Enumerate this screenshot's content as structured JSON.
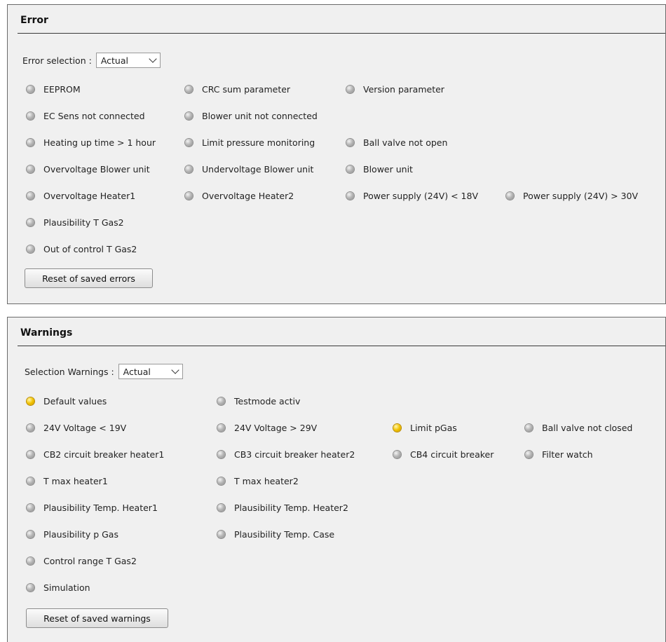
{
  "error_panel": {
    "title": "Error",
    "selection_label": "Error selection :",
    "selection_value": "Actual",
    "items": [
      {
        "label": "EEPROM",
        "color": "gray"
      },
      {
        "label": "CRC sum parameter",
        "color": "gray"
      },
      {
        "label": "Version parameter",
        "color": "gray"
      },
      {
        "label": "EC Sens not connected",
        "color": "gray"
      },
      {
        "label": "Blower unit not connected",
        "color": "gray"
      },
      {
        "label": "Heating up time > 1 hour",
        "color": "gray"
      },
      {
        "label": "Limit pressure monitoring",
        "color": "gray"
      },
      {
        "label": "Ball valve not open",
        "color": "gray"
      },
      {
        "label": "Overvoltage Blower unit",
        "color": "gray"
      },
      {
        "label": "Undervoltage Blower unit",
        "color": "gray"
      },
      {
        "label": "Blower unit",
        "color": "gray"
      },
      {
        "label": "Overvoltage Heater1",
        "color": "gray"
      },
      {
        "label": "Overvoltage Heater2",
        "color": "gray"
      },
      {
        "label": "Power supply (24V) < 18V",
        "color": "gray"
      },
      {
        "label": "Power supply (24V) > 30V",
        "color": "gray"
      },
      {
        "label": "Plausibility T Gas2",
        "color": "gray"
      },
      {
        "label": "Out of control T Gas2",
        "color": "gray"
      }
    ],
    "reset_label": "Reset of saved errors"
  },
  "warnings_panel": {
    "title": "Warnings",
    "selection_label": "Selection Warnings :",
    "selection_value": "Actual",
    "items": [
      {
        "label": "Default values",
        "color": "yellow"
      },
      {
        "label": "Testmode activ",
        "color": "gray"
      },
      {
        "label": "24V Voltage < 19V",
        "color": "gray"
      },
      {
        "label": "24V Voltage > 29V",
        "color": "gray"
      },
      {
        "label": "Limit pGas",
        "color": "yellow"
      },
      {
        "label": "Ball valve not closed",
        "color": "gray"
      },
      {
        "label": "CB2 circuit breaker heater1",
        "color": "gray"
      },
      {
        "label": "CB3 circuit breaker heater2",
        "color": "gray"
      },
      {
        "label": "CB4 circuit breaker",
        "color": "gray"
      },
      {
        "label": "Filter watch",
        "color": "gray"
      },
      {
        "label": "T max heater1",
        "color": "gray"
      },
      {
        "label": "T max heater2",
        "color": "gray"
      },
      {
        "label": "Plausibility Temp. Heater1",
        "color": "gray"
      },
      {
        "label": "Plausibility Temp. Heater2",
        "color": "gray"
      },
      {
        "label": "Plausibility p Gas",
        "color": "gray"
      },
      {
        "label": "Plausibility Temp. Case",
        "color": "gray"
      },
      {
        "label": "Control range T Gas2",
        "color": "gray"
      },
      {
        "label": "Simulation",
        "color": "gray"
      }
    ],
    "reset_label": "Reset of saved warnings"
  }
}
